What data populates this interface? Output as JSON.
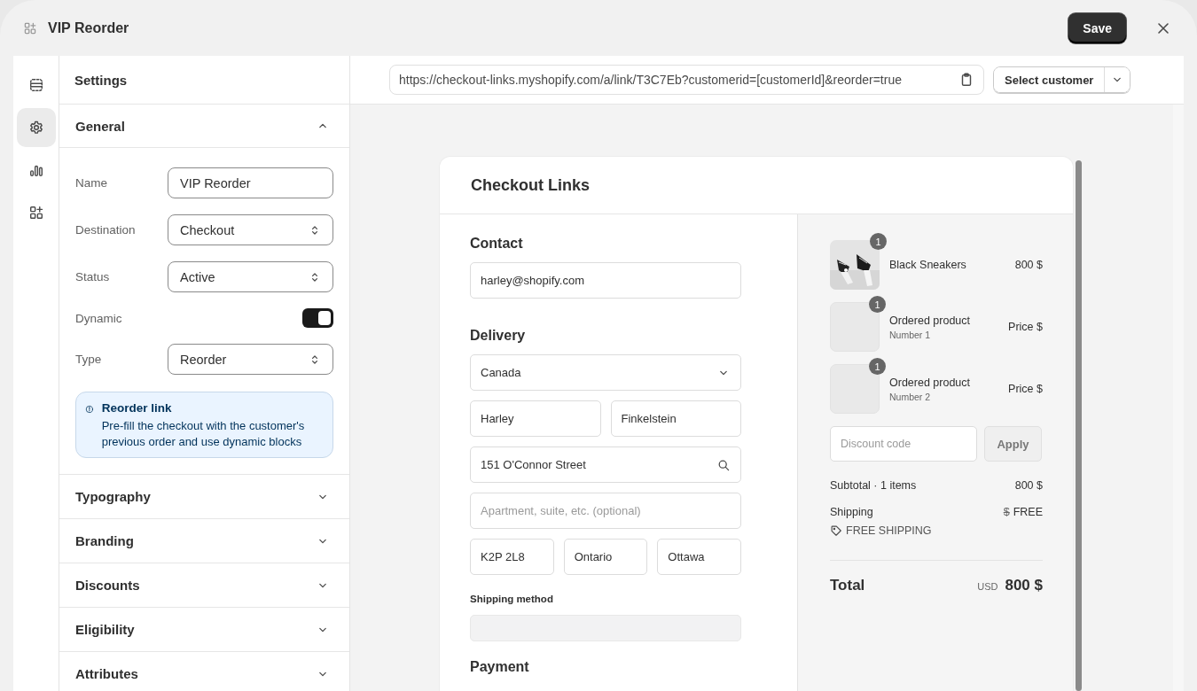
{
  "window": {
    "title": "VIP Reorder",
    "save": "Save"
  },
  "rail": [
    {
      "kind": "blocks",
      "selected": false
    },
    {
      "kind": "settings",
      "selected": true
    },
    {
      "kind": "analytics",
      "selected": false
    },
    {
      "kind": "apps",
      "selected": false
    }
  ],
  "settings": {
    "title": "Settings",
    "sections": [
      {
        "title": "General",
        "expanded": true,
        "fields": [
          {
            "kind": "text",
            "label": "Name",
            "value": "VIP Reorder"
          },
          {
            "kind": "select",
            "label": "Destination",
            "value": "Checkout"
          },
          {
            "kind": "select",
            "label": "Status",
            "value": "Active"
          },
          {
            "kind": "toggle",
            "label": "Dynamic",
            "on": true
          },
          {
            "kind": "select",
            "label": "Type",
            "value": "Reorder"
          }
        ],
        "banner": {
          "title": "Reorder link",
          "text": "Pre-fill the checkout with the customer's previous order and use dynamic blocks"
        }
      },
      {
        "title": "Typography",
        "expanded": false
      },
      {
        "title": "Branding",
        "expanded": false
      },
      {
        "title": "Discounts",
        "expanded": false
      },
      {
        "title": "Eligibility",
        "expanded": false
      },
      {
        "title": "Attributes",
        "expanded": false
      }
    ]
  },
  "url_bar": {
    "url": "https://checkout-links.myshopify.com/a/link/T3C7Eb?customerid=[customerId]&reorder=true",
    "customer_button": "Select customer"
  },
  "preview": {
    "title": "Checkout Links",
    "contact": {
      "heading": "Contact",
      "email": "harley@shopify.com"
    },
    "delivery": {
      "heading": "Delivery",
      "country": "Canada",
      "first_name": "Harley",
      "last_name": "Finkelstein",
      "address": "151 O'Connor Street",
      "apartment_placeholder": "Apartment, suite, etc. (optional)",
      "postal_code": "K2P 2L8",
      "province": "Ontario",
      "city": "Ottawa"
    },
    "shipping_method": {
      "label": "Shipping method"
    },
    "payment": {
      "heading": "Payment"
    },
    "summary": {
      "items": [
        {
          "name": "Black Sneakers",
          "quantity": "1",
          "price": "800 $"
        },
        {
          "kind": "placeholder",
          "name": "Ordered product",
          "variant": "Number 1",
          "quantity": "1",
          "price": "Price $"
        },
        {
          "kind": "placeholder",
          "name": "Ordered product",
          "variant": "Number 2",
          "quantity": "1",
          "price": "Price $"
        }
      ],
      "discount_placeholder": "Discount code",
      "apply": "Apply",
      "subtotal_label": "Subtotal · 1 items",
      "subtotal": "800 $",
      "shipping_label": "Shipping",
      "shipping_old": "$",
      "shipping_value": "FREE",
      "shipping_tag": "FREE SHIPPING",
      "total_label": "Total",
      "currency": "USD",
      "total": "800 $"
    }
  }
}
